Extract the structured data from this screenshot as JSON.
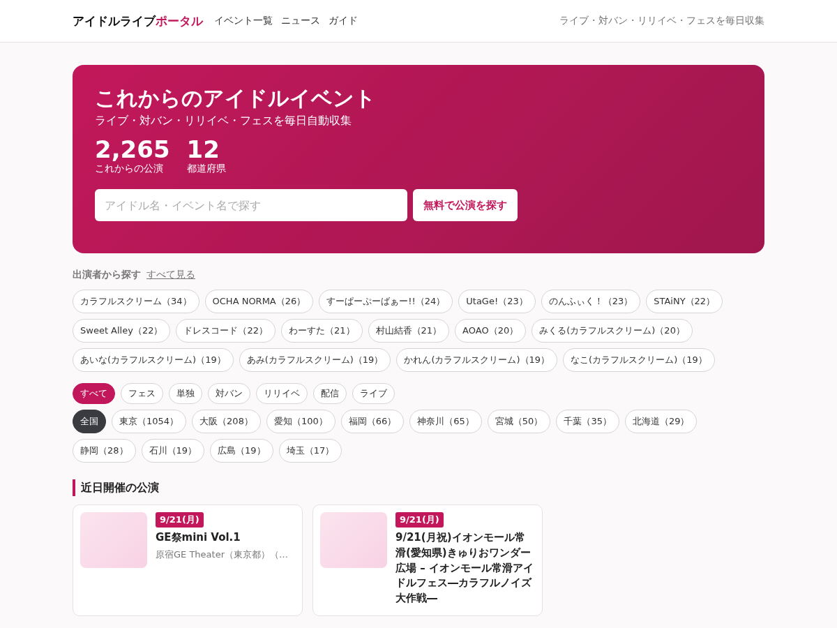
{
  "header": {
    "logo_main": "アイドルライブ",
    "logo_accent": "ポータル",
    "nav": [
      "イベント一覧",
      "ニュース",
      "ガイド"
    ],
    "tagline": "ライブ・対バン・リリイベ・フェスを毎日収集"
  },
  "hero": {
    "title": "これからのアイドルイベント",
    "subtitle": "ライブ・対バン・リリイベ・フェスを毎日自動収集",
    "stats": [
      {
        "value": "2,265",
        "label": "これからの公演"
      },
      {
        "value": "12",
        "label": "都道府県"
      }
    ],
    "search": {
      "placeholder": "アイドル名・イベント名で探す"
    },
    "search_button": "無料で公演を探す"
  },
  "performers": {
    "heading": "出演者から探す",
    "see_all": "すべて見る",
    "chips": [
      {
        "label": "カラフルスクリーム（34）"
      },
      {
        "label": "OCHA NORMA（26）"
      },
      {
        "label": "すーぱーぷーばぁー!!（24）"
      },
      {
        "label": "UtaGe!（23）"
      },
      {
        "label": "のんふぃく！（23）"
      },
      {
        "label": "STAiNY（22）"
      },
      {
        "label": "Sweet Alley（22）"
      },
      {
        "label": "ドレスコード（22）"
      },
      {
        "label": "わーすた（21）"
      },
      {
        "label": "村山結香（21）"
      },
      {
        "label": "AOAO（20）"
      },
      {
        "label": "みくる(カラフルスクリーム)（20）"
      },
      {
        "label": "あいな(カラフルスクリーム)（19）"
      },
      {
        "label": "あみ(カラフルスクリーム)（19）"
      },
      {
        "label": "かれん(カラフルスクリーム)（19）"
      },
      {
        "label": "なこ(カラフルスクリーム)（19）"
      }
    ]
  },
  "type_filters": [
    {
      "label": "すべて",
      "selected": true
    },
    {
      "label": "フェス",
      "selected": false
    },
    {
      "label": "単独",
      "selected": false
    },
    {
      "label": "対バン",
      "selected": false
    },
    {
      "label": "リリイベ",
      "selected": false
    },
    {
      "label": "配信",
      "selected": false
    },
    {
      "label": "ライブ",
      "selected": false
    }
  ],
  "region_filters": [
    {
      "label": "全国",
      "selected": true
    },
    {
      "label": "東京（1054）",
      "selected": false
    },
    {
      "label": "大阪（208）",
      "selected": false
    },
    {
      "label": "愛知（100）",
      "selected": false
    },
    {
      "label": "福岡（66）",
      "selected": false
    },
    {
      "label": "神奈川（65）",
      "selected": false
    },
    {
      "label": "宮城（50）",
      "selected": false
    },
    {
      "label": "千葉（35）",
      "selected": false
    },
    {
      "label": "北海道（29）",
      "selected": false
    },
    {
      "label": "静岡（28）",
      "selected": false
    },
    {
      "label": "石川（19）",
      "selected": false
    },
    {
      "label": "広島（19）",
      "selected": false
    },
    {
      "label": "埼玉（17）",
      "selected": false
    }
  ],
  "upcoming": {
    "heading": "近日開催の公演",
    "events": [
      {
        "date": "9/21(月)",
        "title": "GE祭mini Vol.1",
        "venue": "原宿GE Theater（東京都）（…"
      },
      {
        "date": "9/21(月)",
        "title": "9/21(月祝)イオンモール常滑(愛知県)きゅりおワンダー広場 – イオンモール常滑アイドルフェス―カラフルノイズ大作戦―"
      }
    ]
  }
}
